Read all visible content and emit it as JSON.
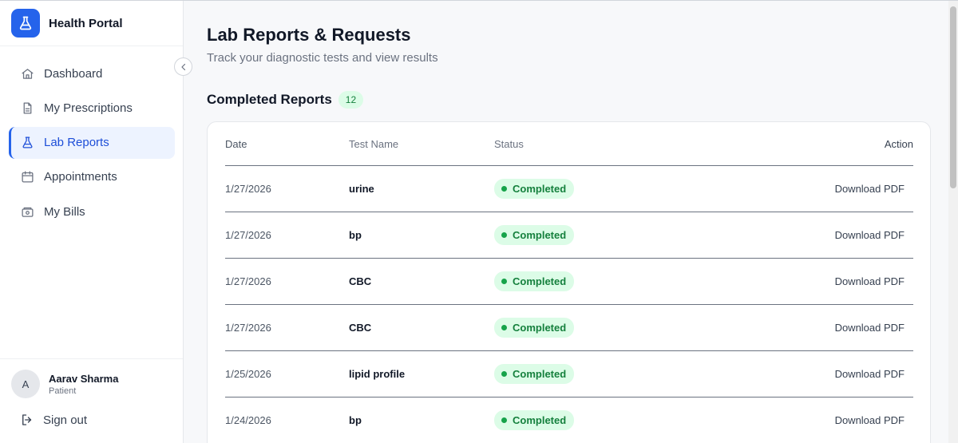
{
  "brand": {
    "title": "Health Portal"
  },
  "sidebar": {
    "items": [
      {
        "label": "Dashboard",
        "icon": "home-icon",
        "active": false
      },
      {
        "label": "My Prescriptions",
        "icon": "document-icon",
        "active": false
      },
      {
        "label": "Lab Reports",
        "icon": "flask-icon",
        "active": true
      },
      {
        "label": "Appointments",
        "icon": "calendar-icon",
        "active": false
      },
      {
        "label": "My Bills",
        "icon": "wallet-icon",
        "active": false
      }
    ],
    "user": {
      "initial": "A",
      "name": "Aarav Sharma",
      "role": "Patient"
    },
    "signout_label": "Sign out"
  },
  "page": {
    "title": "Lab Reports & Requests",
    "subtitle": "Track your diagnostic tests and view results"
  },
  "section": {
    "title": "Completed Reports",
    "count": "12"
  },
  "table": {
    "headers": {
      "date": "Date",
      "test_name": "Test Name",
      "status": "Status",
      "action": "Action"
    },
    "rows": [
      {
        "date": "1/27/2026",
        "test_name": "urine",
        "status": "Completed",
        "action": "Download PDF"
      },
      {
        "date": "1/27/2026",
        "test_name": "bp",
        "status": "Completed",
        "action": "Download PDF"
      },
      {
        "date": "1/27/2026",
        "test_name": "CBC",
        "status": "Completed",
        "action": "Download PDF"
      },
      {
        "date": "1/27/2026",
        "test_name": "CBC",
        "status": "Completed",
        "action": "Download PDF"
      },
      {
        "date": "1/25/2026",
        "test_name": "lipid profile",
        "status": "Completed",
        "action": "Download PDF"
      },
      {
        "date": "1/24/2026",
        "test_name": "bp",
        "status": "Completed",
        "action": "Download PDF"
      }
    ]
  },
  "colors": {
    "accent": "#2563eb",
    "active_bg": "#edf3ff",
    "status_bg": "#dcfce7",
    "status_text": "#15803d"
  }
}
